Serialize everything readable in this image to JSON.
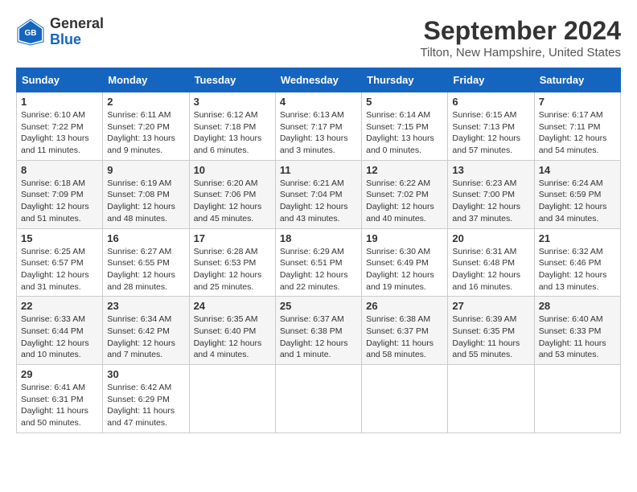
{
  "header": {
    "logo_general": "General",
    "logo_blue": "Blue",
    "month_year": "September 2024",
    "location": "Tilton, New Hampshire, United States"
  },
  "days_of_week": [
    "Sunday",
    "Monday",
    "Tuesday",
    "Wednesday",
    "Thursday",
    "Friday",
    "Saturday"
  ],
  "weeks": [
    [
      {
        "day": "1",
        "sunrise": "Sunrise: 6:10 AM",
        "sunset": "Sunset: 7:22 PM",
        "daylight": "Daylight: 13 hours and 11 minutes."
      },
      {
        "day": "2",
        "sunrise": "Sunrise: 6:11 AM",
        "sunset": "Sunset: 7:20 PM",
        "daylight": "Daylight: 13 hours and 9 minutes."
      },
      {
        "day": "3",
        "sunrise": "Sunrise: 6:12 AM",
        "sunset": "Sunset: 7:18 PM",
        "daylight": "Daylight: 13 hours and 6 minutes."
      },
      {
        "day": "4",
        "sunrise": "Sunrise: 6:13 AM",
        "sunset": "Sunset: 7:17 PM",
        "daylight": "Daylight: 13 hours and 3 minutes."
      },
      {
        "day": "5",
        "sunrise": "Sunrise: 6:14 AM",
        "sunset": "Sunset: 7:15 PM",
        "daylight": "Daylight: 13 hours and 0 minutes."
      },
      {
        "day": "6",
        "sunrise": "Sunrise: 6:15 AM",
        "sunset": "Sunset: 7:13 PM",
        "daylight": "Daylight: 12 hours and 57 minutes."
      },
      {
        "day": "7",
        "sunrise": "Sunrise: 6:17 AM",
        "sunset": "Sunset: 7:11 PM",
        "daylight": "Daylight: 12 hours and 54 minutes."
      }
    ],
    [
      {
        "day": "8",
        "sunrise": "Sunrise: 6:18 AM",
        "sunset": "Sunset: 7:09 PM",
        "daylight": "Daylight: 12 hours and 51 minutes."
      },
      {
        "day": "9",
        "sunrise": "Sunrise: 6:19 AM",
        "sunset": "Sunset: 7:08 PM",
        "daylight": "Daylight: 12 hours and 48 minutes."
      },
      {
        "day": "10",
        "sunrise": "Sunrise: 6:20 AM",
        "sunset": "Sunset: 7:06 PM",
        "daylight": "Daylight: 12 hours and 45 minutes."
      },
      {
        "day": "11",
        "sunrise": "Sunrise: 6:21 AM",
        "sunset": "Sunset: 7:04 PM",
        "daylight": "Daylight: 12 hours and 43 minutes."
      },
      {
        "day": "12",
        "sunrise": "Sunrise: 6:22 AM",
        "sunset": "Sunset: 7:02 PM",
        "daylight": "Daylight: 12 hours and 40 minutes."
      },
      {
        "day": "13",
        "sunrise": "Sunrise: 6:23 AM",
        "sunset": "Sunset: 7:00 PM",
        "daylight": "Daylight: 12 hours and 37 minutes."
      },
      {
        "day": "14",
        "sunrise": "Sunrise: 6:24 AM",
        "sunset": "Sunset: 6:59 PM",
        "daylight": "Daylight: 12 hours and 34 minutes."
      }
    ],
    [
      {
        "day": "15",
        "sunrise": "Sunrise: 6:25 AM",
        "sunset": "Sunset: 6:57 PM",
        "daylight": "Daylight: 12 hours and 31 minutes."
      },
      {
        "day": "16",
        "sunrise": "Sunrise: 6:27 AM",
        "sunset": "Sunset: 6:55 PM",
        "daylight": "Daylight: 12 hours and 28 minutes."
      },
      {
        "day": "17",
        "sunrise": "Sunrise: 6:28 AM",
        "sunset": "Sunset: 6:53 PM",
        "daylight": "Daylight: 12 hours and 25 minutes."
      },
      {
        "day": "18",
        "sunrise": "Sunrise: 6:29 AM",
        "sunset": "Sunset: 6:51 PM",
        "daylight": "Daylight: 12 hours and 22 minutes."
      },
      {
        "day": "19",
        "sunrise": "Sunrise: 6:30 AM",
        "sunset": "Sunset: 6:49 PM",
        "daylight": "Daylight: 12 hours and 19 minutes."
      },
      {
        "day": "20",
        "sunrise": "Sunrise: 6:31 AM",
        "sunset": "Sunset: 6:48 PM",
        "daylight": "Daylight: 12 hours and 16 minutes."
      },
      {
        "day": "21",
        "sunrise": "Sunrise: 6:32 AM",
        "sunset": "Sunset: 6:46 PM",
        "daylight": "Daylight: 12 hours and 13 minutes."
      }
    ],
    [
      {
        "day": "22",
        "sunrise": "Sunrise: 6:33 AM",
        "sunset": "Sunset: 6:44 PM",
        "daylight": "Daylight: 12 hours and 10 minutes."
      },
      {
        "day": "23",
        "sunrise": "Sunrise: 6:34 AM",
        "sunset": "Sunset: 6:42 PM",
        "daylight": "Daylight: 12 hours and 7 minutes."
      },
      {
        "day": "24",
        "sunrise": "Sunrise: 6:35 AM",
        "sunset": "Sunset: 6:40 PM",
        "daylight": "Daylight: 12 hours and 4 minutes."
      },
      {
        "day": "25",
        "sunrise": "Sunrise: 6:37 AM",
        "sunset": "Sunset: 6:38 PM",
        "daylight": "Daylight: 12 hours and 1 minute."
      },
      {
        "day": "26",
        "sunrise": "Sunrise: 6:38 AM",
        "sunset": "Sunset: 6:37 PM",
        "daylight": "Daylight: 11 hours and 58 minutes."
      },
      {
        "day": "27",
        "sunrise": "Sunrise: 6:39 AM",
        "sunset": "Sunset: 6:35 PM",
        "daylight": "Daylight: 11 hours and 55 minutes."
      },
      {
        "day": "28",
        "sunrise": "Sunrise: 6:40 AM",
        "sunset": "Sunset: 6:33 PM",
        "daylight": "Daylight: 11 hours and 53 minutes."
      }
    ],
    [
      {
        "day": "29",
        "sunrise": "Sunrise: 6:41 AM",
        "sunset": "Sunset: 6:31 PM",
        "daylight": "Daylight: 11 hours and 50 minutes."
      },
      {
        "day": "30",
        "sunrise": "Sunrise: 6:42 AM",
        "sunset": "Sunset: 6:29 PM",
        "daylight": "Daylight: 11 hours and 47 minutes."
      },
      null,
      null,
      null,
      null,
      null
    ]
  ]
}
